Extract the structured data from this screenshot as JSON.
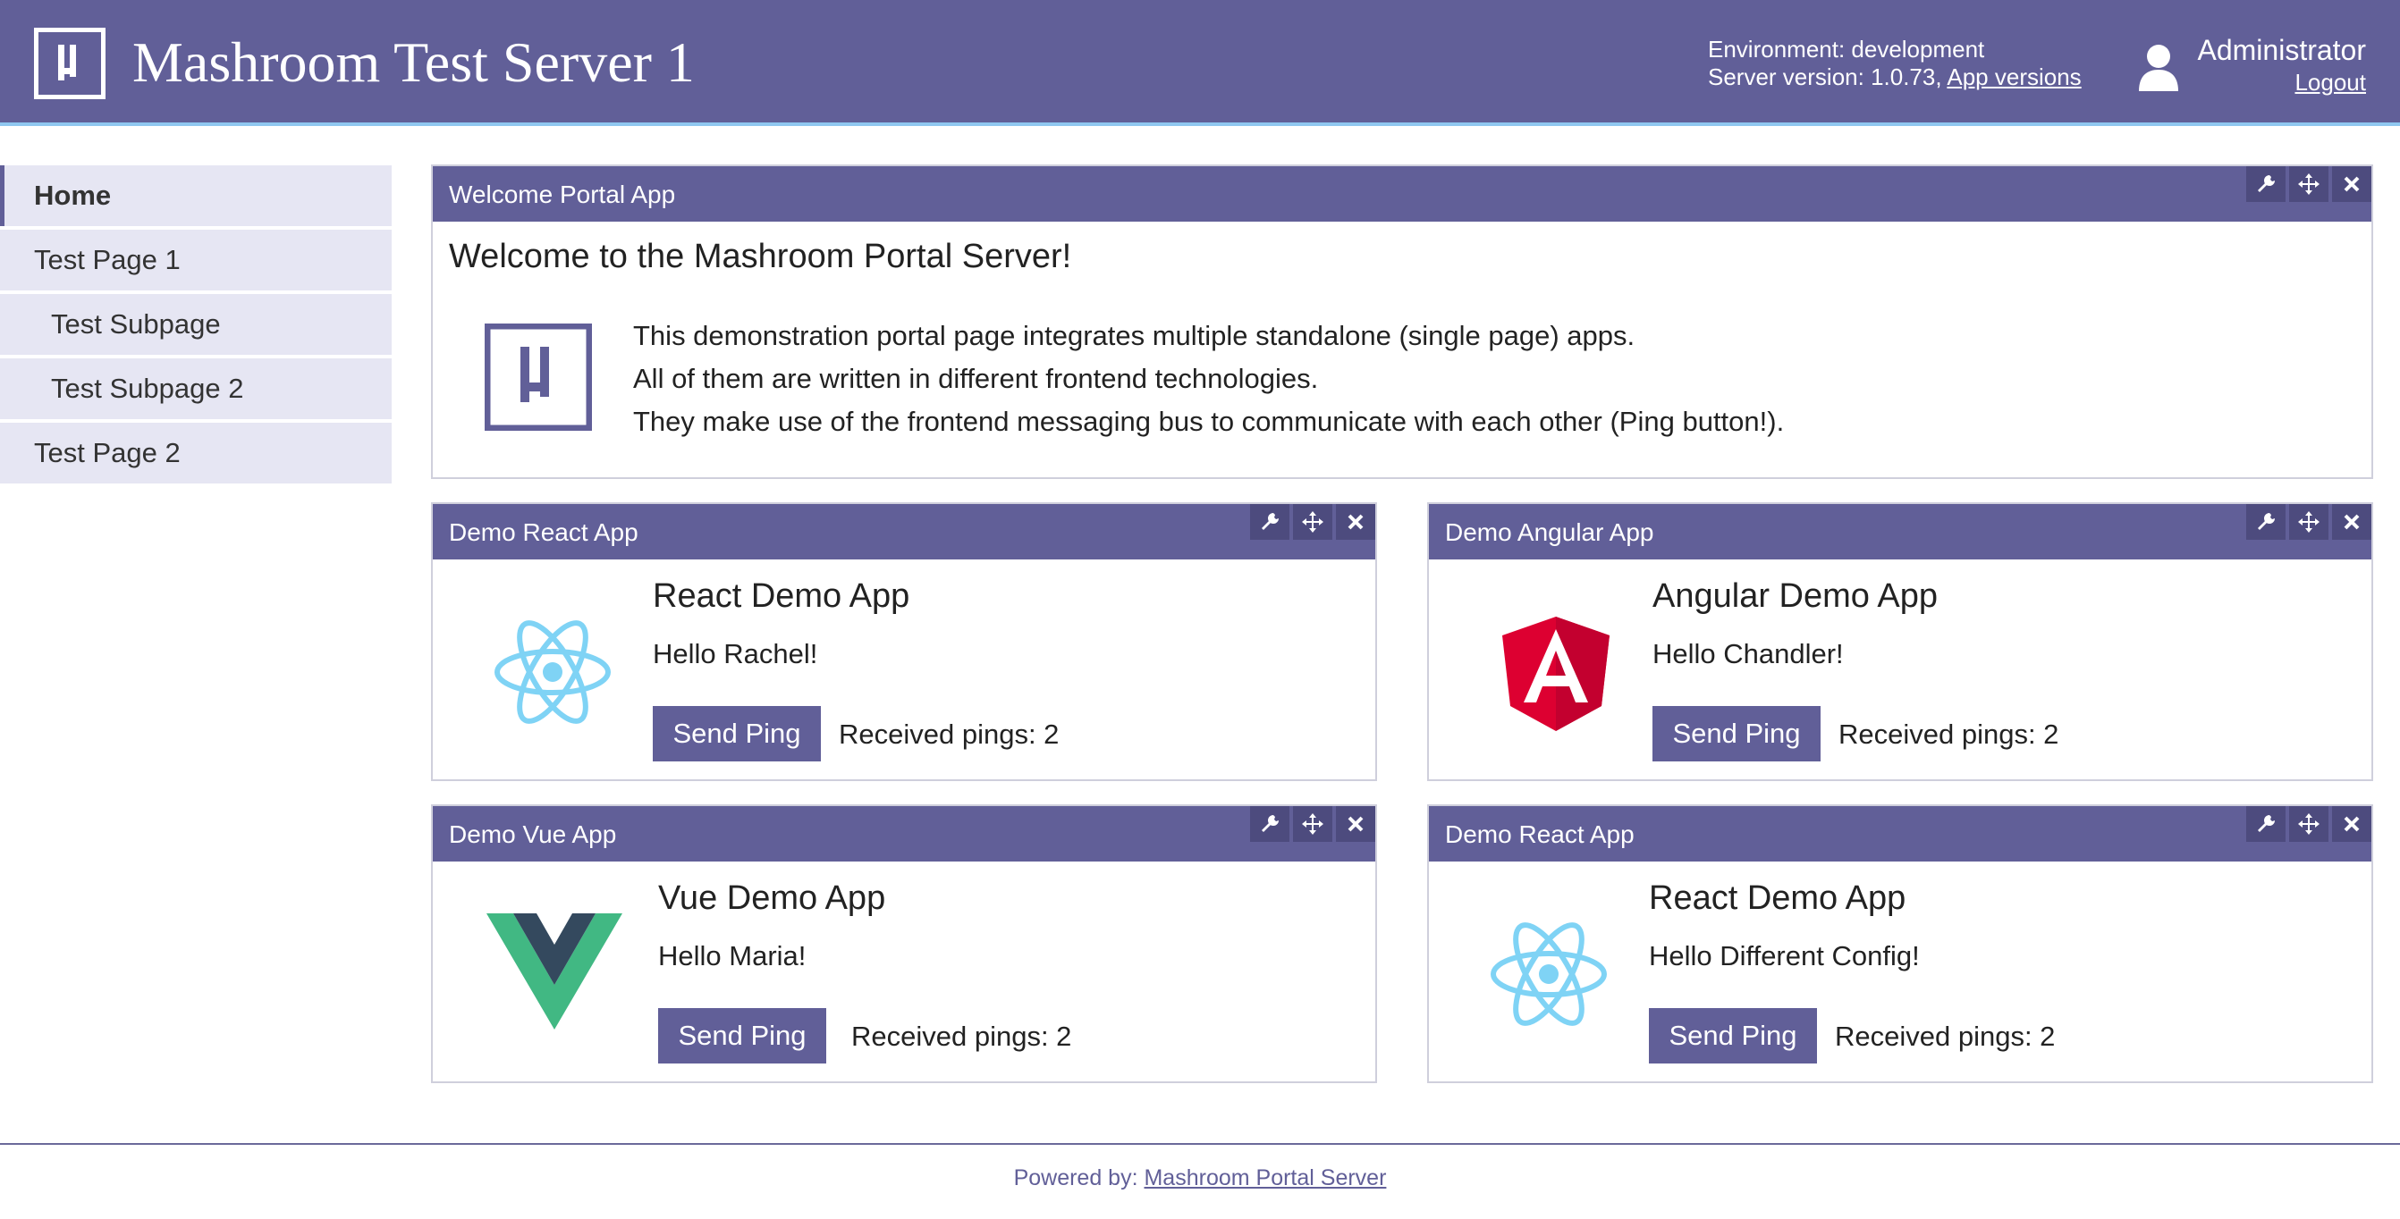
{
  "header": {
    "title": "Mashroom Test Server 1",
    "environment": "Environment: development",
    "server_version": "Server version: 1.0.73,",
    "app_versions_link": "App versions",
    "user_name": "Administrator",
    "logout_link": "Logout"
  },
  "nav": {
    "items": [
      {
        "label": "Home",
        "active": true
      },
      {
        "label": "Test Page 1"
      },
      {
        "label": "Test Subpage"
      },
      {
        "label": "Test Subpage 2"
      },
      {
        "label": "Test Page 2"
      }
    ]
  },
  "welcome_app": {
    "title": "Welcome Portal App",
    "heading": "Welcome to the Mashroom Portal Server!",
    "lines": [
      "This demonstration portal page integrates multiple standalone (single page) apps.",
      "All of them are written in different frontend technologies.",
      "They make use of the frontend messaging bus to communicate with each other (Ping button!)."
    ]
  },
  "apps": [
    {
      "title": "Demo React App",
      "heading": "React Demo App",
      "greeting": "Hello Rachel!",
      "button": "Send Ping",
      "pings": "Received pings: 2",
      "icon": "react-logo-icon"
    },
    {
      "title": "Demo Angular App",
      "heading": "Angular Demo App",
      "greeting": "Hello Chandler!",
      "button": "Send Ping",
      "pings": "Received pings: 2",
      "icon": "angular-logo-icon"
    },
    {
      "title": "Demo Vue App",
      "heading": "Vue Demo App",
      "greeting": "Hello Maria!",
      "button": "Send Ping",
      "pings": "Received pings: 2",
      "icon": "vue-logo-icon"
    },
    {
      "title": "Demo React App",
      "heading": "React Demo App",
      "greeting": "Hello Different Config!",
      "button": "Send Ping",
      "pings": "Received pings: 2",
      "icon": "react-logo-icon"
    }
  ],
  "footer": {
    "prefix": "Powered by:",
    "link": "Mashroom Portal Server"
  },
  "colors": {
    "primary": "#615f98",
    "header_border": "#8fc7f0",
    "nav_background": "#e6e6f3",
    "react": "#7fd3f5",
    "angular": "#c3002f",
    "vue_green": "#41b883",
    "vue_dark": "#34495e"
  }
}
